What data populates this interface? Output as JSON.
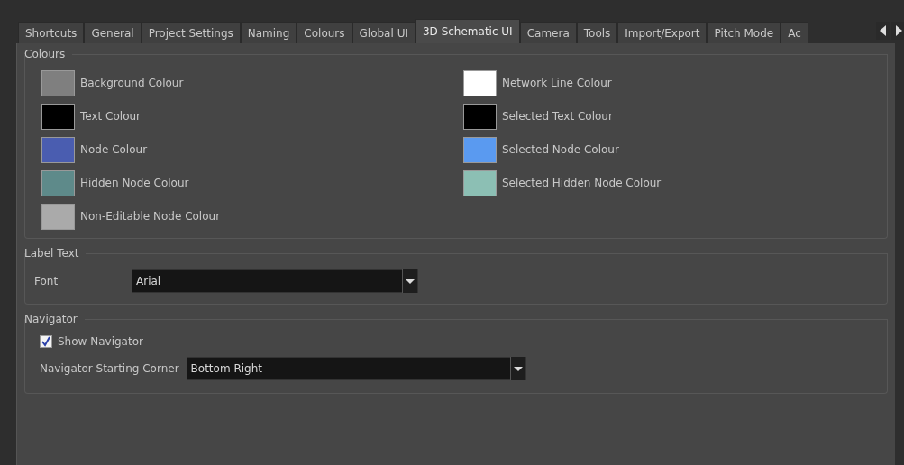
{
  "tabs": [
    {
      "label": "Shortcuts",
      "selected": false
    },
    {
      "label": "General",
      "selected": false
    },
    {
      "label": "Project Settings",
      "selected": false
    },
    {
      "label": "Naming",
      "selected": false
    },
    {
      "label": "Colours",
      "selected": false
    },
    {
      "label": "Global UI",
      "selected": false
    },
    {
      "label": "3D Schematic UI",
      "selected": true
    },
    {
      "label": "Camera",
      "selected": false
    },
    {
      "label": "Tools",
      "selected": false
    },
    {
      "label": "Import/Export",
      "selected": false
    },
    {
      "label": "Pitch Mode",
      "selected": false
    },
    {
      "label": "Ac",
      "selected": false
    }
  ],
  "colours": {
    "title": "Colours",
    "left": [
      {
        "label": "Background Colour",
        "color": "#7f7f7f"
      },
      {
        "label": "Text Colour",
        "color": "#000000"
      },
      {
        "label": "Node Colour",
        "color": "#4a5db0"
      },
      {
        "label": "Hidden Node Colour",
        "color": "#5e8a8a"
      },
      {
        "label": "Non-Editable Node Colour",
        "color": "#aaaaaa"
      }
    ],
    "right": [
      {
        "label": "Network Line Colour",
        "color": "#ffffff"
      },
      {
        "label": "Selected Text Colour",
        "color": "#000000"
      },
      {
        "label": "Selected Node Colour",
        "color": "#5a9af0"
      },
      {
        "label": "Selected Hidden Node Colour",
        "color": "#8cbfb4"
      }
    ]
  },
  "label_text": {
    "title": "Label Text",
    "font_label": "Font",
    "font_value": "Arial"
  },
  "navigator": {
    "title": "Navigator",
    "show_navigator": {
      "label": "Show Navigator",
      "checked": true
    },
    "corner_label": "Navigator Starting Corner",
    "corner_value": "Bottom Right"
  }
}
